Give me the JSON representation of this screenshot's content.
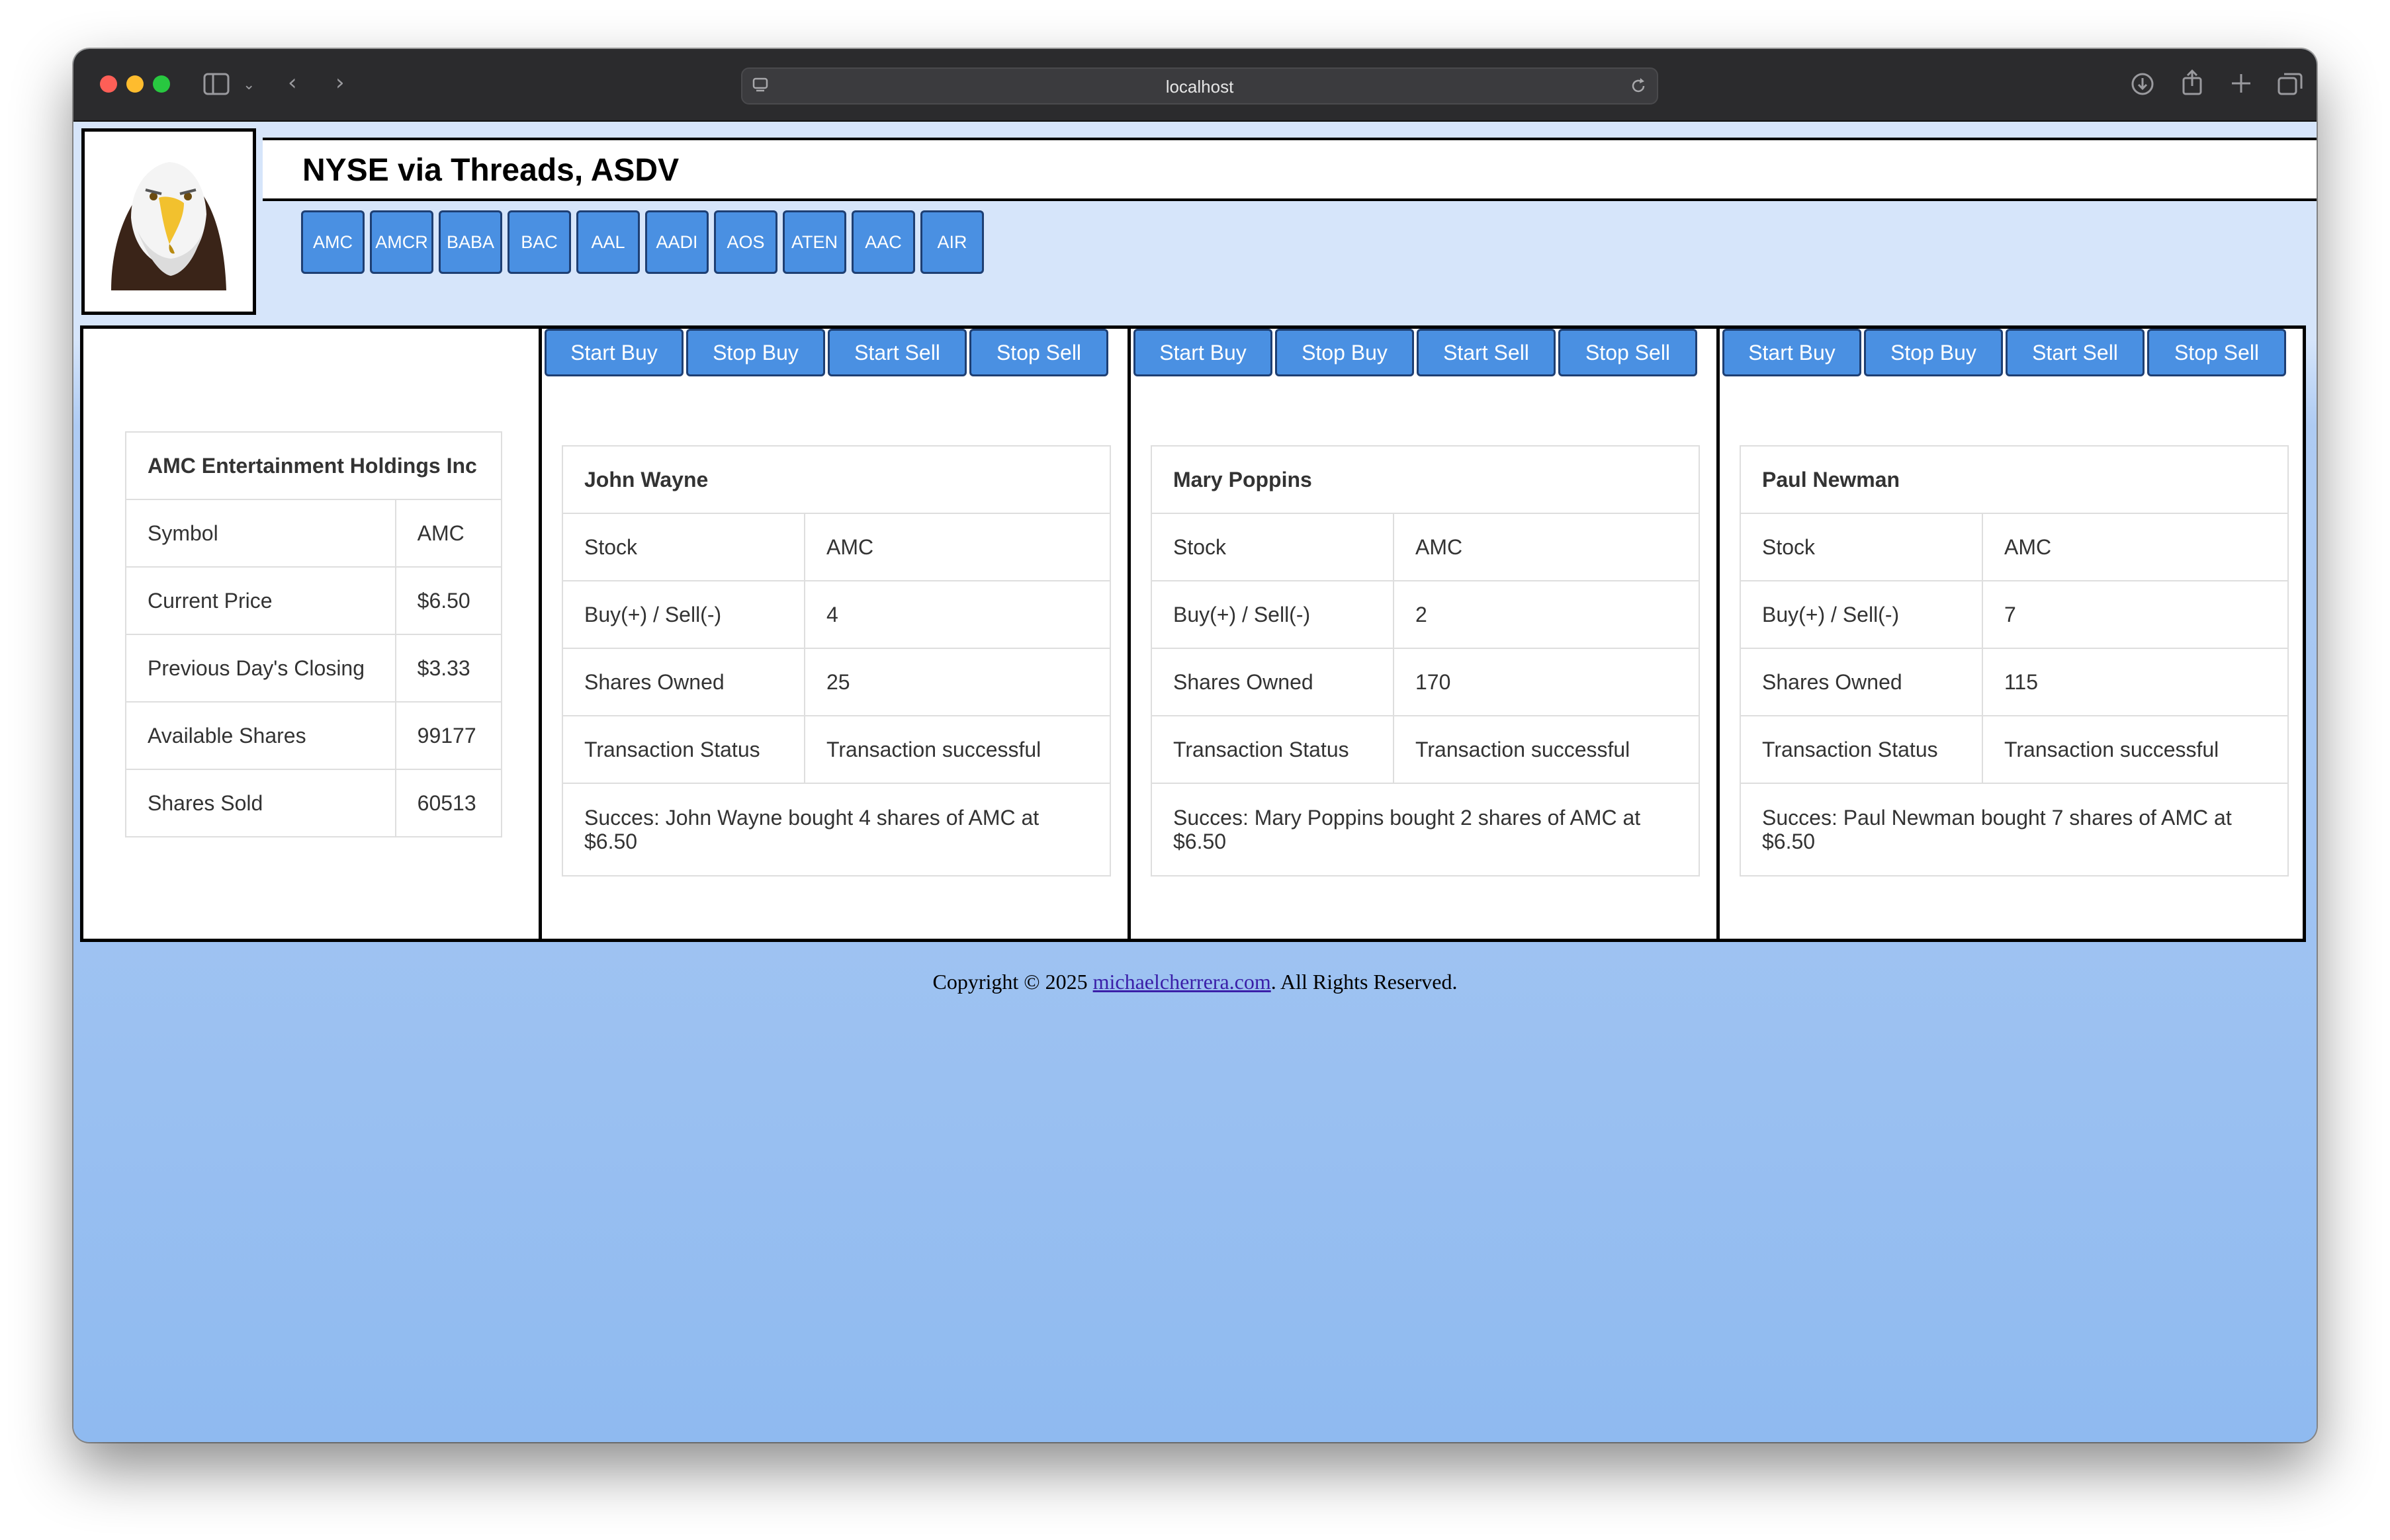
{
  "browser": {
    "url": "localhost"
  },
  "header": {
    "title": "NYSE via Threads, ASDV",
    "logo_icon": "eagle-icon"
  },
  "stock_buttons": [
    "AMC",
    "AMCR",
    "BABA",
    "BAC",
    "AAL",
    "AADI",
    "AOS",
    "ATEN",
    "AAC",
    "AIR"
  ],
  "actions": {
    "start_buy": "Start Buy",
    "stop_buy": "Stop Buy",
    "start_sell": "Start Sell",
    "stop_sell": "Stop Sell"
  },
  "stock_info": {
    "company": "AMC Entertainment Holdings Inc",
    "rows": [
      {
        "label": "Symbol",
        "value": "AMC"
      },
      {
        "label": "Current Price",
        "value": "$6.50"
      },
      {
        "label": "Previous Day's Closing",
        "value": "$3.33"
      },
      {
        "label": "Available Shares",
        "value": "99177"
      },
      {
        "label": "Shares Sold",
        "value": "60513"
      }
    ]
  },
  "row_labels": {
    "stock": "Stock",
    "buy_sell": "Buy(+) / Sell(-)",
    "shares_owned": "Shares Owned",
    "status": "Transaction Status"
  },
  "traders": [
    {
      "name": "John Wayne",
      "stock": "AMC",
      "buy_sell": "4",
      "shares_owned": "25",
      "status": "Transaction successful",
      "message": "Succes: John Wayne bought 4 shares of AMC at $6.50"
    },
    {
      "name": "Mary Poppins",
      "stock": "AMC",
      "buy_sell": "2",
      "shares_owned": "170",
      "status": "Transaction successful",
      "message": "Succes: Mary Poppins bought 2 shares of AMC at $6.50"
    },
    {
      "name": "Paul Newman",
      "stock": "AMC",
      "buy_sell": "7",
      "shares_owned": "115",
      "status": "Transaction successful",
      "message": "Succes: Paul Newman bought 7 shares of AMC at $6.50"
    }
  ],
  "footer": {
    "prefix": "Copyright © 2025 ",
    "link": "michaelcherrera.com",
    "suffix": ". All Rights Reserved."
  }
}
